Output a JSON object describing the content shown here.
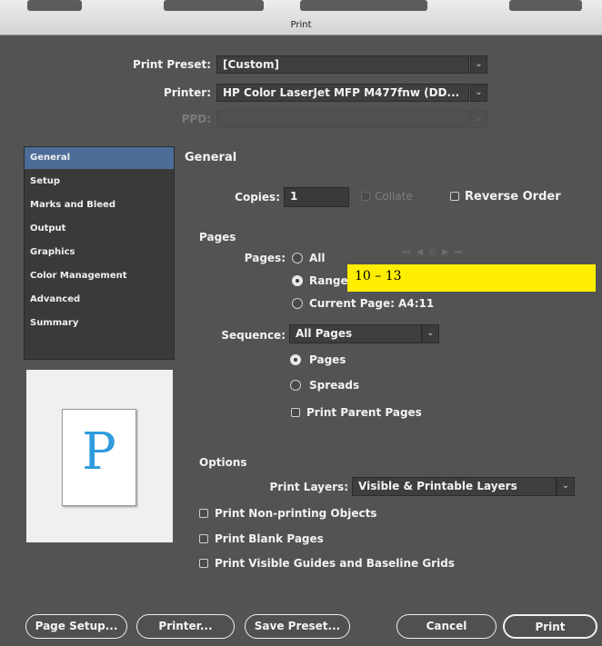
{
  "window": {
    "title": "Print"
  },
  "header": {
    "print_preset_label": "Print Preset:",
    "print_preset_value": "[Custom]",
    "printer_label": "Printer:",
    "printer_value": "HP Color LaserJet MFP M477fnw (DD...",
    "ppd_label": "PPD:",
    "ppd_value": ""
  },
  "sidebar": {
    "items": [
      {
        "label": "General",
        "selected": true
      },
      {
        "label": "Setup"
      },
      {
        "label": "Marks and Bleed"
      },
      {
        "label": "Output"
      },
      {
        "label": "Graphics"
      },
      {
        "label": "Color Management"
      },
      {
        "label": "Advanced"
      },
      {
        "label": "Summary"
      }
    ]
  },
  "preview": {
    "letter": "P",
    "accent_color": "#2f9bdc"
  },
  "general": {
    "section_title": "General",
    "copies_label": "Copies:",
    "copies_value": "1",
    "collate_label": "Collate",
    "reverse_order_label": "Reverse Order"
  },
  "pages": {
    "section_title": "Pages",
    "pages_label": "Pages:",
    "all_label": "All",
    "range_label": "Range:",
    "range_value": "10 – 13",
    "current_page_label": "Current Page: A4:11",
    "sequence_label": "Sequence:",
    "sequence_value": "All Pages",
    "pages_option_label": "Pages",
    "spreads_option_label": "Spreads",
    "print_parent_pages_label": "Print Parent Pages",
    "selected_option": "Range"
  },
  "options": {
    "section_title": "Options",
    "print_layers_label": "Print Layers:",
    "print_layers_value": "Visible & Printable Layers",
    "print_non_printing_label": "Print Non-printing Objects",
    "print_blank_pages_label": "Print Blank Pages",
    "print_visible_guides_label": "Print Visible Guides and Baseline Grids"
  },
  "buttons": {
    "page_setup": "Page Setup...",
    "printer": "Printer...",
    "save_preset": "Save Preset...",
    "cancel": "Cancel",
    "print": "Print"
  },
  "colors": {
    "highlight": "#ffee00",
    "selection": "#4d6d99",
    "background": "#535353"
  },
  "icons": [
    "chevron-down-icon",
    "first-page-icon",
    "previous-page-icon",
    "print-preview-icon",
    "next-page-icon",
    "last-page-icon"
  ]
}
